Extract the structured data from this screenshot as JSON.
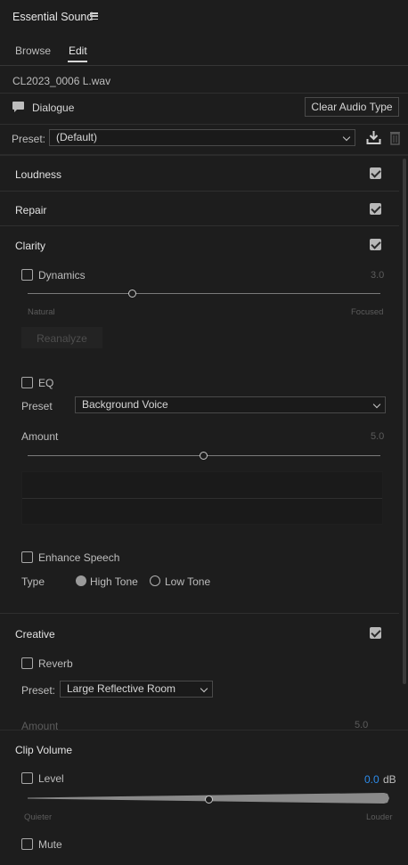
{
  "panel": {
    "title": "Essential Sound"
  },
  "tabs": [
    {
      "label": "Browse",
      "active": false
    },
    {
      "label": "Edit",
      "active": true
    }
  ],
  "clip": {
    "filename": "CL2023_0006 L.wav",
    "type_label": "Dialogue",
    "clear_button": "Clear Audio Type"
  },
  "preset": {
    "label": "Preset:",
    "value": "(Default)"
  },
  "sections": {
    "loudness": {
      "title": "Loudness",
      "enabled": true
    },
    "repair": {
      "title": "Repair",
      "enabled": true
    },
    "clarity": {
      "title": "Clarity",
      "enabled": true,
      "dynamics": {
        "label": "Dynamics",
        "value": "3.0",
        "min_label": "Natural",
        "max_label": "Focused",
        "reanalyze": "Reanalyze",
        "level": 0.3
      },
      "eq": {
        "label": "EQ",
        "preset_label": "Preset",
        "preset_value": "Background Voice",
        "amount_label": "Amount",
        "amount_value": "5.0",
        "level": 0.5
      },
      "enhance": {
        "label": "Enhance Speech",
        "type_label": "Type",
        "high_tone": "High Tone",
        "low_tone": "Low Tone",
        "selected": "High Tone"
      }
    },
    "creative": {
      "title": "Creative",
      "enabled": true,
      "reverb": {
        "label": "Reverb",
        "preset_label": "Preset:",
        "preset_value": "Large Reflective Room",
        "amount_label": "Amount",
        "amount_value": "5.0"
      }
    },
    "clip_volume": {
      "title": "Clip Volume",
      "level": {
        "label": "Level",
        "value": "0.0",
        "unit": "dB",
        "min_label": "Quieter",
        "max_label": "Louder",
        "position": 0.5
      },
      "mute": {
        "label": "Mute"
      }
    }
  },
  "colors": {
    "accent": "#2d8ceb",
    "background": "#1d1d1d",
    "checkbox": "#b8b8b8"
  }
}
